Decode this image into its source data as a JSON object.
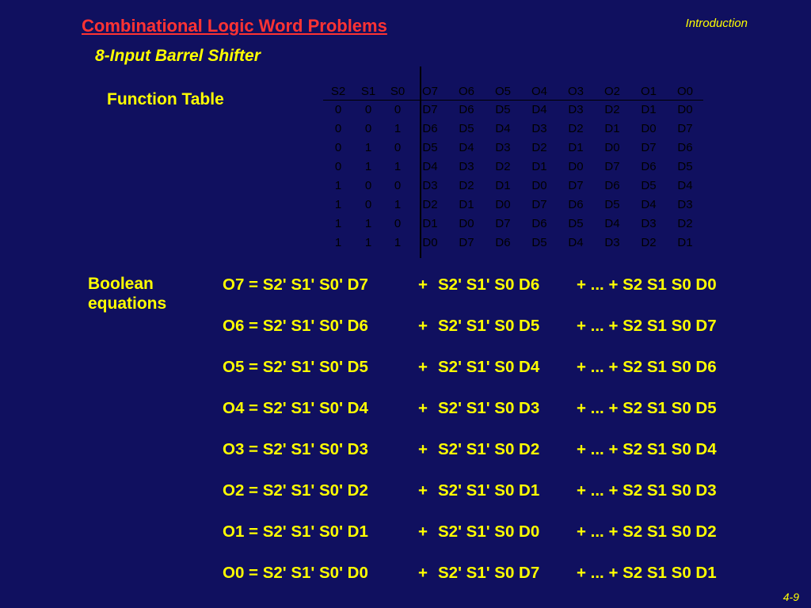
{
  "header": {
    "title": "Combinational Logic Word Problems",
    "section": "Introduction",
    "subtitle": "8-Input Barrel Shifter"
  },
  "function_table": {
    "label": "Function Table",
    "select_headers": [
      "S2",
      "S1",
      "S0"
    ],
    "output_headers": [
      "O7",
      "O6",
      "O5",
      "O4",
      "O3",
      "O2",
      "O1",
      "O0"
    ],
    "rows": [
      {
        "sel": [
          "0",
          "0",
          "0"
        ],
        "out": [
          "D7",
          "D6",
          "D5",
          "D4",
          "D3",
          "D2",
          "D1",
          "D0"
        ]
      },
      {
        "sel": [
          "0",
          "0",
          "1"
        ],
        "out": [
          "D6",
          "D5",
          "D4",
          "D3",
          "D2",
          "D1",
          "D0",
          "D7"
        ]
      },
      {
        "sel": [
          "0",
          "1",
          "0"
        ],
        "out": [
          "D5",
          "D4",
          "D3",
          "D2",
          "D1",
          "D0",
          "D7",
          "D6"
        ]
      },
      {
        "sel": [
          "0",
          "1",
          "1"
        ],
        "out": [
          "D4",
          "D3",
          "D2",
          "D1",
          "D0",
          "D7",
          "D6",
          "D5"
        ]
      },
      {
        "sel": [
          "1",
          "0",
          "0"
        ],
        "out": [
          "D3",
          "D2",
          "D1",
          "D0",
          "D7",
          "D6",
          "D5",
          "D4"
        ]
      },
      {
        "sel": [
          "1",
          "0",
          "1"
        ],
        "out": [
          "D2",
          "D1",
          "D0",
          "D7",
          "D6",
          "D5",
          "D4",
          "D3"
        ]
      },
      {
        "sel": [
          "1",
          "1",
          "0"
        ],
        "out": [
          "D1",
          "D0",
          "D7",
          "D6",
          "D5",
          "D4",
          "D3",
          "D2"
        ]
      },
      {
        "sel": [
          "1",
          "1",
          "1"
        ],
        "out": [
          "D0",
          "D7",
          "D6",
          "D5",
          "D4",
          "D3",
          "D2",
          "D1"
        ]
      }
    ]
  },
  "boolean": {
    "label_line1": "Boolean",
    "label_line2": "equations",
    "equations": [
      {
        "lhs": "O7 = S2' S1' S0' D7",
        "plus": "+",
        "mid": "S2' S1' S0 D6",
        "tail": "+ ... + S2 S1 S0 D0"
      },
      {
        "lhs": "O6 = S2' S1' S0' D6",
        "plus": "+",
        "mid": "S2' S1' S0 D5",
        "tail": "+ ... + S2 S1 S0 D7"
      },
      {
        "lhs": "O5 = S2' S1' S0' D5",
        "plus": "+",
        "mid": "S2' S1' S0 D4",
        "tail": "+ ... + S2 S1 S0 D6"
      },
      {
        "lhs": "O4 = S2' S1' S0' D4",
        "plus": "+",
        "mid": "S2' S1' S0 D3",
        "tail": "+ ... + S2 S1 S0 D5"
      },
      {
        "lhs": "O3 = S2' S1' S0' D3",
        "plus": "+",
        "mid": "S2' S1' S0 D2",
        "tail": "+ ... + S2 S1 S0 D4"
      },
      {
        "lhs": "O2 = S2' S1' S0' D2",
        "plus": "+",
        "mid": "S2' S1' S0 D1",
        "tail": "+ ... + S2 S1 S0 D3"
      },
      {
        "lhs": "O1 = S2' S1' S0' D1",
        "plus": "+",
        "mid": "S2' S1' S0 D0",
        "tail": "+ ... + S2 S1 S0 D2"
      },
      {
        "lhs": "O0 = S2' S1' S0' D0",
        "plus": "+",
        "mid": "S2' S1' S0 D7",
        "tail": "+ ... + S2 S1 S0 D1"
      }
    ]
  },
  "footer": {
    "page": "4-9"
  },
  "colors": {
    "background": "#10105f",
    "title": "#ff3333",
    "text": "#ffff00",
    "table_text": "#000000"
  }
}
